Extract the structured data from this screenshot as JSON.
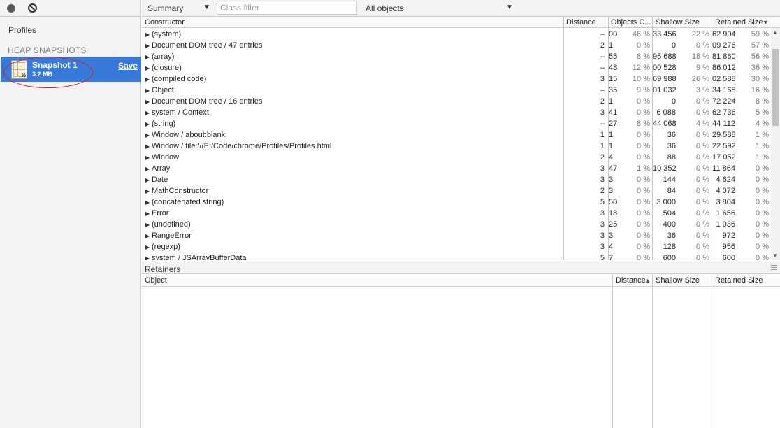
{
  "sidebar": {
    "profiles_title": "Profiles",
    "section_title": "HEAP SNAPSHOTS",
    "snapshot": {
      "name": "Snapshot 1",
      "size": "3.2 MB",
      "save_label": "Save",
      "icon_badge": "%"
    }
  },
  "toolbar": {
    "view": "Summary",
    "class_filter_placeholder": "Class filter",
    "objects": "All objects"
  },
  "grid": {
    "headers": {
      "constructor": "Constructor",
      "distance": "Distance",
      "objects": "Objects C...",
      "shallow": "Shallow Size",
      "retained": "Retained Size",
      "sort_arrow": "▼"
    },
    "rows": [
      [
        "(system)",
        "–",
        "00",
        "46 %",
        "33 456",
        "22 %",
        "62 904",
        "59 %"
      ],
      [
        "Document DOM tree / 47 entries",
        "2",
        "1",
        "0 %",
        "0",
        "0 %",
        "09 276",
        "57 %"
      ],
      [
        "(array)",
        "–",
        "55",
        "8 %",
        "95 688",
        "18 %",
        "81 860",
        "56 %"
      ],
      [
        "(closure)",
        "–",
        "48",
        "12 %",
        "00 528",
        "9 %",
        "86 012",
        "36 %"
      ],
      [
        "(compiled code)",
        "3",
        "15",
        "10 %",
        "69 988",
        "26 %",
        "02 588",
        "30 %"
      ],
      [
        "Object",
        "–",
        "35",
        "9 %",
        "01 032",
        "3 %",
        "34 168",
        "16 %"
      ],
      [
        "Document DOM tree / 16 entries",
        "2",
        "1",
        "0 %",
        "0",
        "0 %",
        "72 224",
        "8 %"
      ],
      [
        "system / Context",
        "3",
        "41",
        "0 %",
        "6 088",
        "0 %",
        "62 736",
        "5 %"
      ],
      [
        "(string)",
        "–",
        "27",
        "8 %",
        "44 068",
        "4 %",
        "44 112",
        "4 %"
      ],
      [
        "Window / about:blank",
        "1",
        "1",
        "0 %",
        "36",
        "0 %",
        "29 588",
        "1 %"
      ],
      [
        "Window / file:///E:/Code/chrome/Profiles/Profiles.html",
        "1",
        "1",
        "0 %",
        "36",
        "0 %",
        "22 592",
        "1 %"
      ],
      [
        "Window",
        "2",
        "4",
        "0 %",
        "88",
        "0 %",
        "17 052",
        "1 %"
      ],
      [
        "Array",
        "3",
        "47",
        "1 %",
        "10 352",
        "0 %",
        "11 864",
        "0 %"
      ],
      [
        "Date",
        "3",
        "3",
        "0 %",
        "144",
        "0 %",
        "4 624",
        "0 %"
      ],
      [
        "MathConstructor",
        "2",
        "3",
        "0 %",
        "84",
        "0 %",
        "4 072",
        "0 %"
      ],
      [
        "(concatenated string)",
        "5",
        "50",
        "0 %",
        "3 000",
        "0 %",
        "3 804",
        "0 %"
      ],
      [
        "Error",
        "3",
        "18",
        "0 %",
        "504",
        "0 %",
        "1 656",
        "0 %"
      ],
      [
        "(undefined)",
        "3",
        "25",
        "0 %",
        "400",
        "0 %",
        "1 036",
        "0 %"
      ],
      [
        "RangeError",
        "3",
        "3",
        "0 %",
        "36",
        "0 %",
        "972",
        "0 %"
      ],
      [
        "(regexp)",
        "3",
        "4",
        "0 %",
        "128",
        "0 %",
        "956",
        "0 %"
      ],
      [
        "system / JSArrayBufferData",
        "5",
        "7",
        "0 %",
        "600",
        "0 %",
        "600",
        "0 %"
      ]
    ]
  },
  "retainers": {
    "title": "Retainers",
    "headers": {
      "object": "Object",
      "distance": "Distance",
      "sort_arrow": "▲",
      "shallow": "Shallow Size",
      "retained": "Retained Size"
    }
  },
  "icons": [
    "record-icon",
    "clear-icon",
    "heap-snapshot-icon",
    "dropdown-arrow-icon",
    "expand-triangle-icon",
    "resize-handle-icon"
  ],
  "colors": {
    "selected": "#3879d9",
    "annotation_ring": "#d62020"
  }
}
